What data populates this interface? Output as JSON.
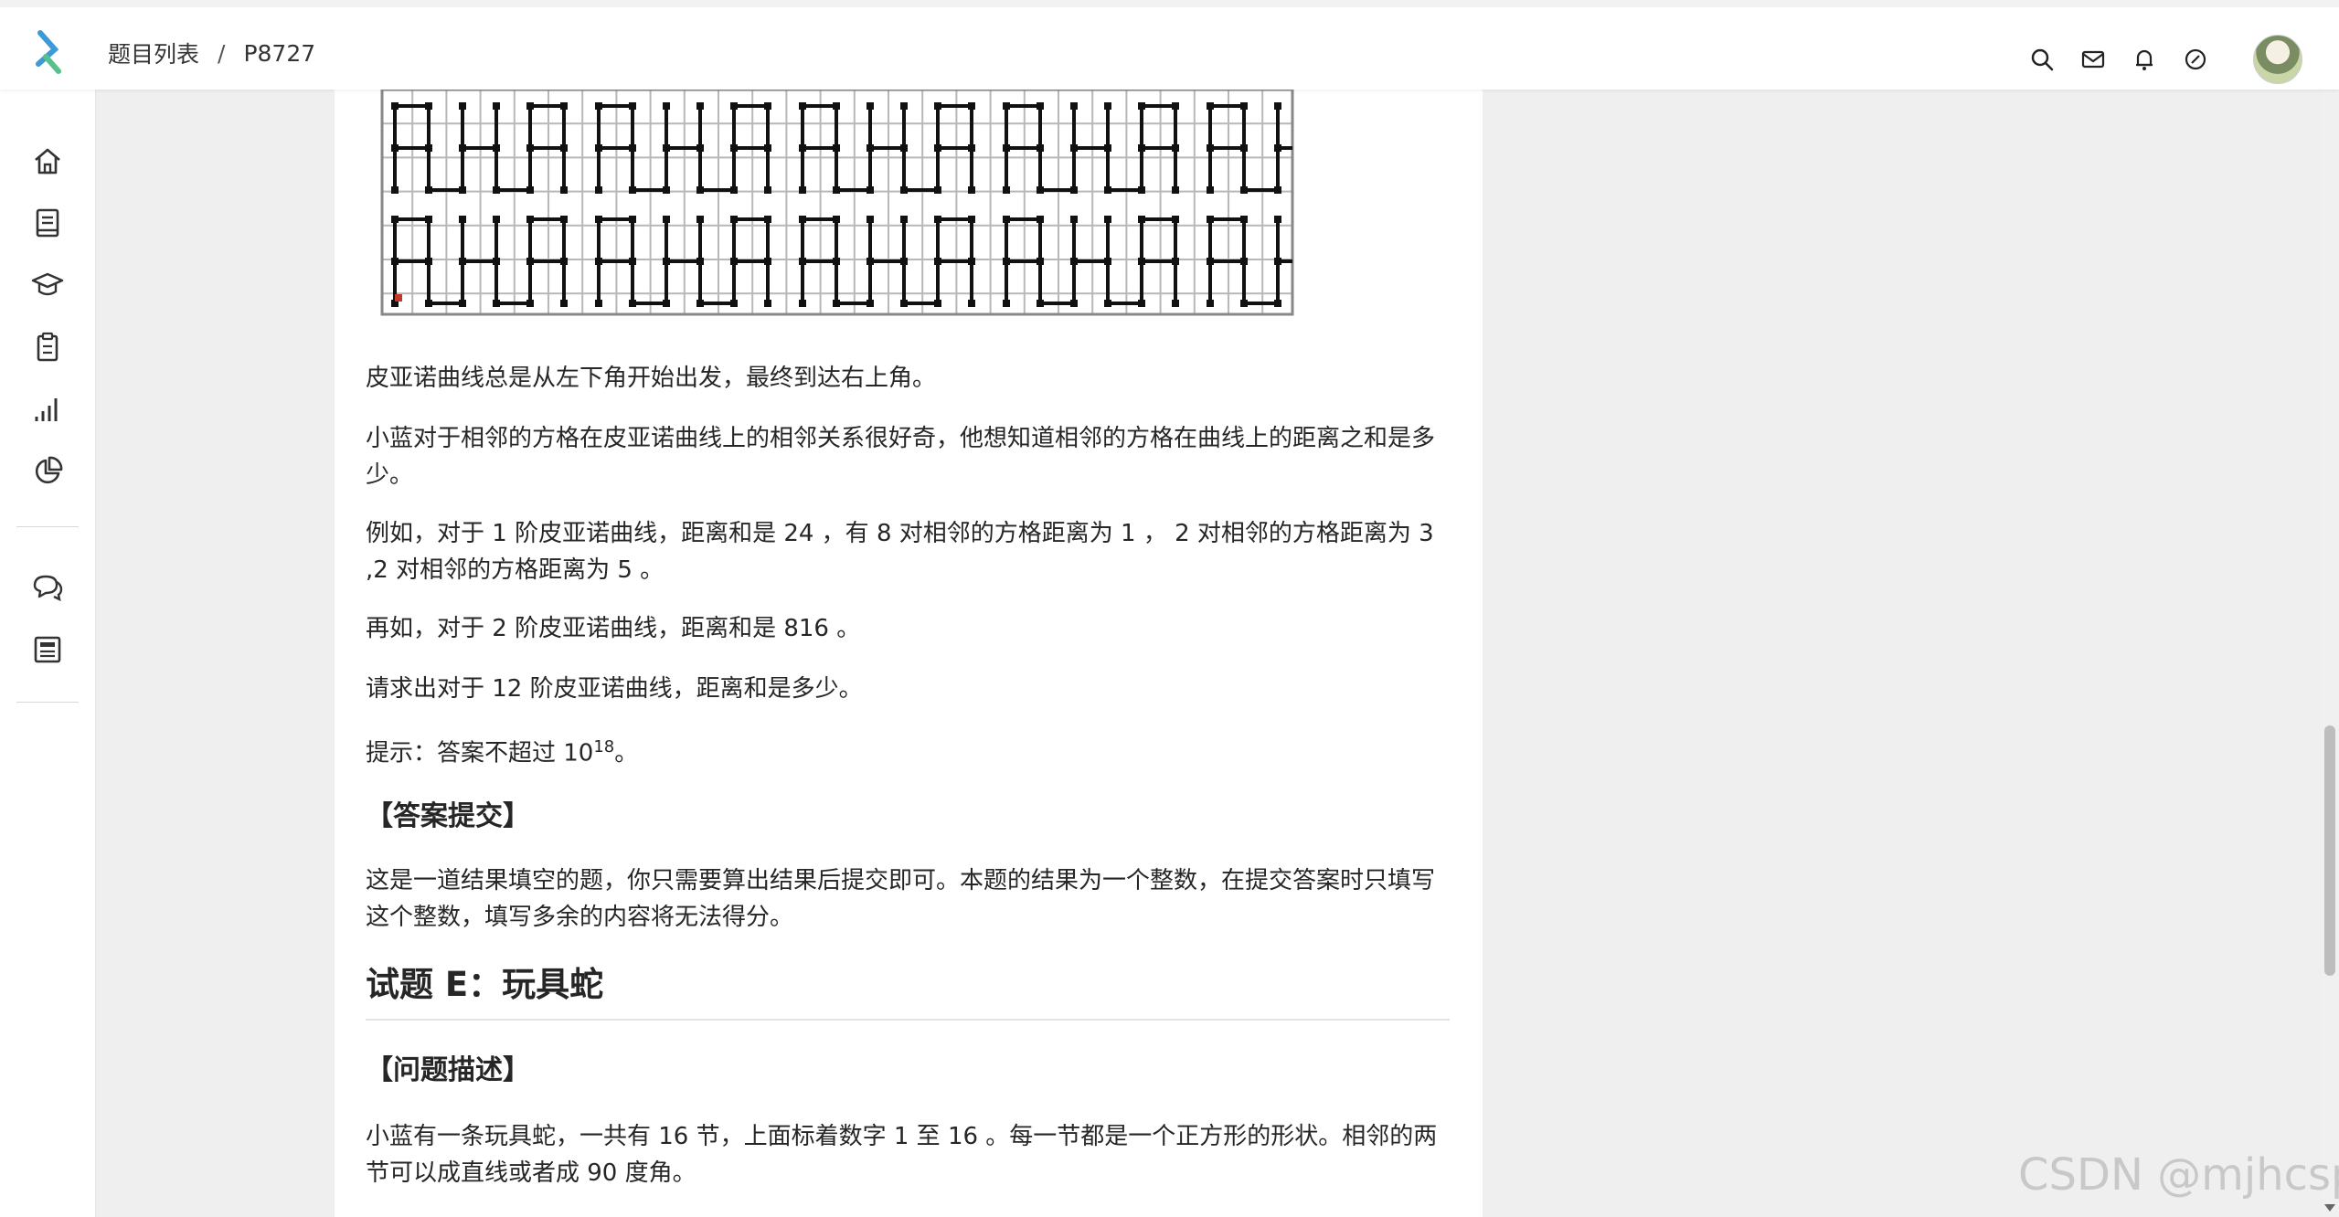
{
  "header": {
    "breadcrumb_root": "题目列表",
    "breadcrumb_sep": "/",
    "breadcrumb_current": "P8727"
  },
  "sidebar": {
    "items": [
      "home-icon",
      "book-icon",
      "graduation-cap-icon",
      "clipboard-icon",
      "bar-chart-icon",
      "pie-chart-icon",
      "chat-icon",
      "news-icon"
    ]
  },
  "article": {
    "p1": "皮亚诺曲线总是从左下角开始出发，最终到达右上角。",
    "p2": "小蓝对于相邻的方格在皮亚诺曲线上的相邻关系很好奇，他想知道相邻的方格在曲线上的距离之和是多少。",
    "p3": "例如，对于 1 阶皮亚诺曲线，距离和是 24 ，有 8 对相邻的方格距离为 1 ， 2 对相邻的方格距离为 3 ,2 对相邻的方格距离为 5 。",
    "p4": "再如，对于 2 阶皮亚诺曲线，距离和是 816 。",
    "p5": "请求出对于 12 阶皮亚诺曲线，距离和是多少。",
    "p6_prefix": "提示：答案不超过 10",
    "p6_sup": "18",
    "p6_suffix": "。",
    "h_submit": "【答案提交】",
    "p7": "这是一道结果填空的题，你只需要算出结果后提交即可。本题的结果为一个整数，在提交答案时只填写这个整数，填写多余的内容将无法得分。",
    "h_problem": "试题 E：玩具蛇",
    "h_desc": "【问题描述】",
    "p8": "小蓝有一条玩具蛇，一共有 16 节，上面标着数字 1 至 16 。每一节都是一个正方形的形状。相邻的两节可以成直线或者成 90 度角。"
  },
  "watermark": "CSDN @mjhcsp",
  "colors": {
    "accent": "#3c9ad8",
    "text": "#262626",
    "background": "#efefef"
  }
}
